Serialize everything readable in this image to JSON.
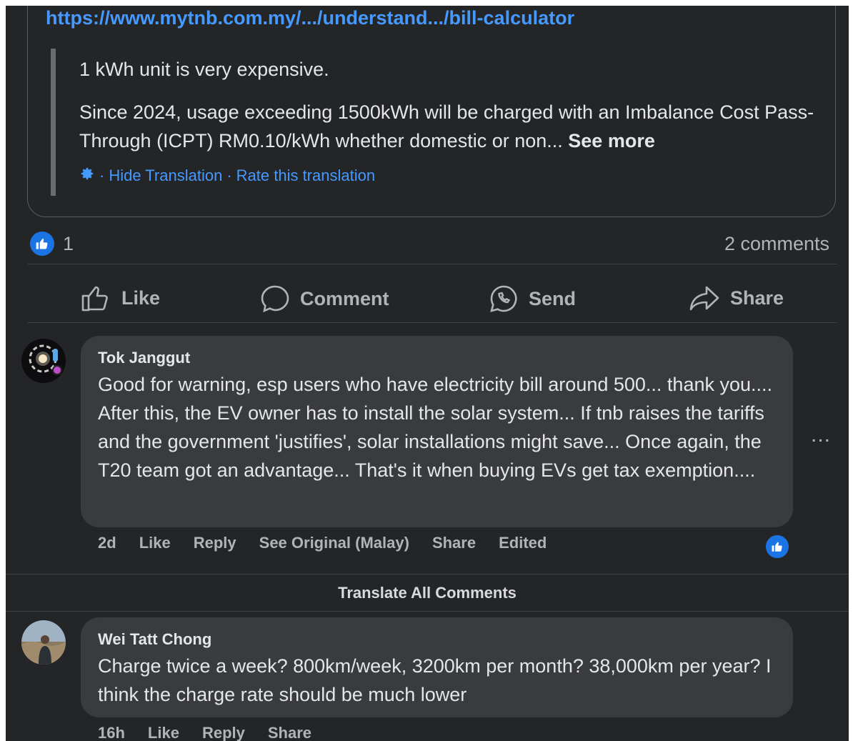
{
  "post": {
    "link_text": "https://www.mytnb.com.my/.../understand.../bill-calculator",
    "quote_line1": "1 kWh unit is very expensive.",
    "quote_line2": "Since 2024, usage exceeding 1500kWh will be charged with an Imbalance Cost Pass-Through (ICPT) RM0.10/kWh whether domestic or non...",
    "see_more": "See more",
    "translation": {
      "icon": "gear-icon",
      "sep1": "·",
      "hide": "Hide Translation",
      "sep2": "·",
      "rate": "Rate this translation"
    }
  },
  "reactions": {
    "count": "1",
    "comments": "2 comments"
  },
  "actions": {
    "like": "Like",
    "comment": "Comment",
    "send": "Send",
    "share": "Share"
  },
  "comments": [
    {
      "author": "Tok Janggut",
      "text": "Good for warning, esp users who have electricity bill around 500... thank you.... After this, the EV owner has to install the solar system... If tnb raises the tariffs and the government 'justifies', solar installations might save... Once again, the T20 team got an advantage... That's it when buying EVs get tax exemption....",
      "time": "2d",
      "like": "Like",
      "reply": "Reply",
      "see_original": "See Original (Malay)",
      "share": "Share",
      "edited": "Edited",
      "more": "..."
    },
    {
      "author": "Wei Tatt Chong",
      "text": "Charge twice a week? 800km/week, 3200km per month? 38,000km per year? I think the charge rate should be much lower",
      "time": "16h",
      "like": "Like",
      "reply": "Reply",
      "share": "Share"
    }
  ],
  "translate_all": "Translate All Comments",
  "colors": {
    "background": "#242526",
    "bubble": "#3a3b3c",
    "link": "#4599ff",
    "like_blue": "#1b74e4",
    "secondary_text": "#b0b3b8"
  }
}
